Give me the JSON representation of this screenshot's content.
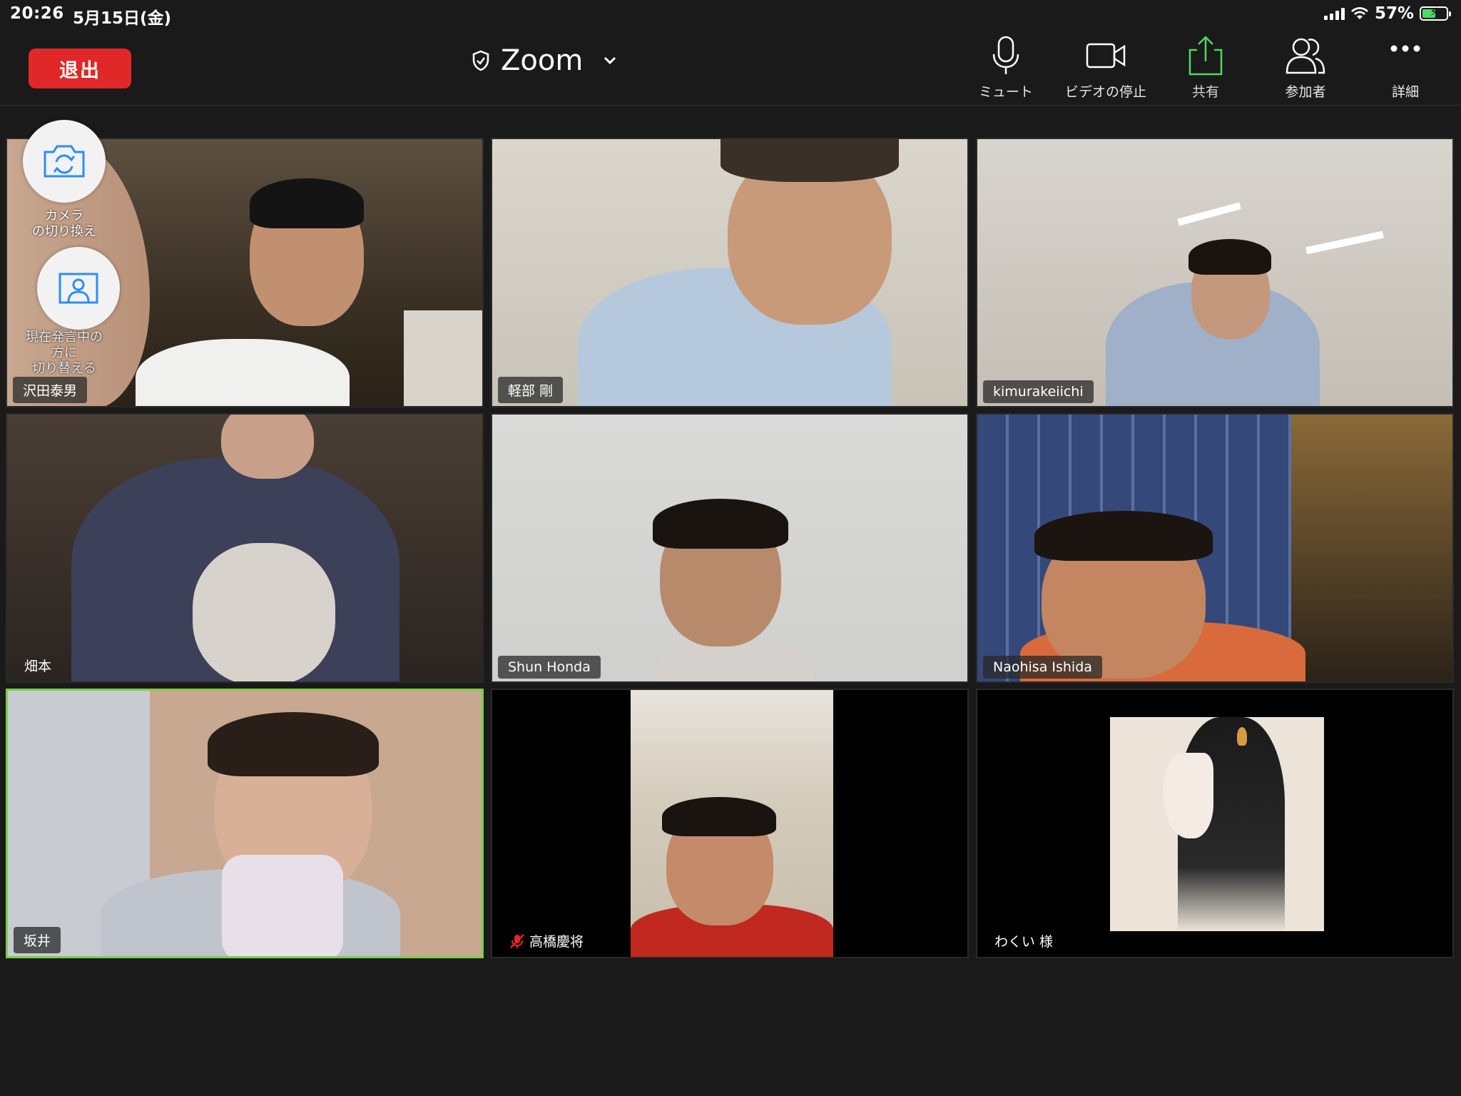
{
  "status_bar": {
    "time": "20:26",
    "date": "5月15日(金)",
    "battery_percent": "57%",
    "battery_level": 0.57,
    "charging": true
  },
  "toolbar": {
    "leave_label": "退出",
    "title": "Zoom",
    "mute_label": "ミュート",
    "stop_video_label": "ビデオの停止",
    "share_label": "共有",
    "participants_label": "参加者",
    "more_label": "詳細"
  },
  "overlay": {
    "switch_camera_label": "カメラ\nの切り換え",
    "switch_speaker_label": "現在発言中の\n方に\n切り替える"
  },
  "participants": [
    {
      "name": "沢田泰男",
      "active": false,
      "muted": false
    },
    {
      "name": "軽部 剛",
      "active": false,
      "muted": false
    },
    {
      "name": "kimurakeiichi",
      "active": false,
      "muted": false
    },
    {
      "name": "畑本",
      "active": false,
      "muted": false
    },
    {
      "name": "Shun Honda",
      "active": false,
      "muted": false
    },
    {
      "name": "Naohisa Ishida",
      "active": false,
      "muted": false
    },
    {
      "name": "坂井",
      "active": true,
      "muted": false
    },
    {
      "name": "高橋慶将",
      "active": false,
      "muted": true
    },
    {
      "name": "わくい 様",
      "active": false,
      "muted": false
    }
  ],
  "colors": {
    "leave": "#e02828",
    "share_icon": "#4cd964",
    "active_border": "#7bd046",
    "muted_icon": "#e02828"
  }
}
